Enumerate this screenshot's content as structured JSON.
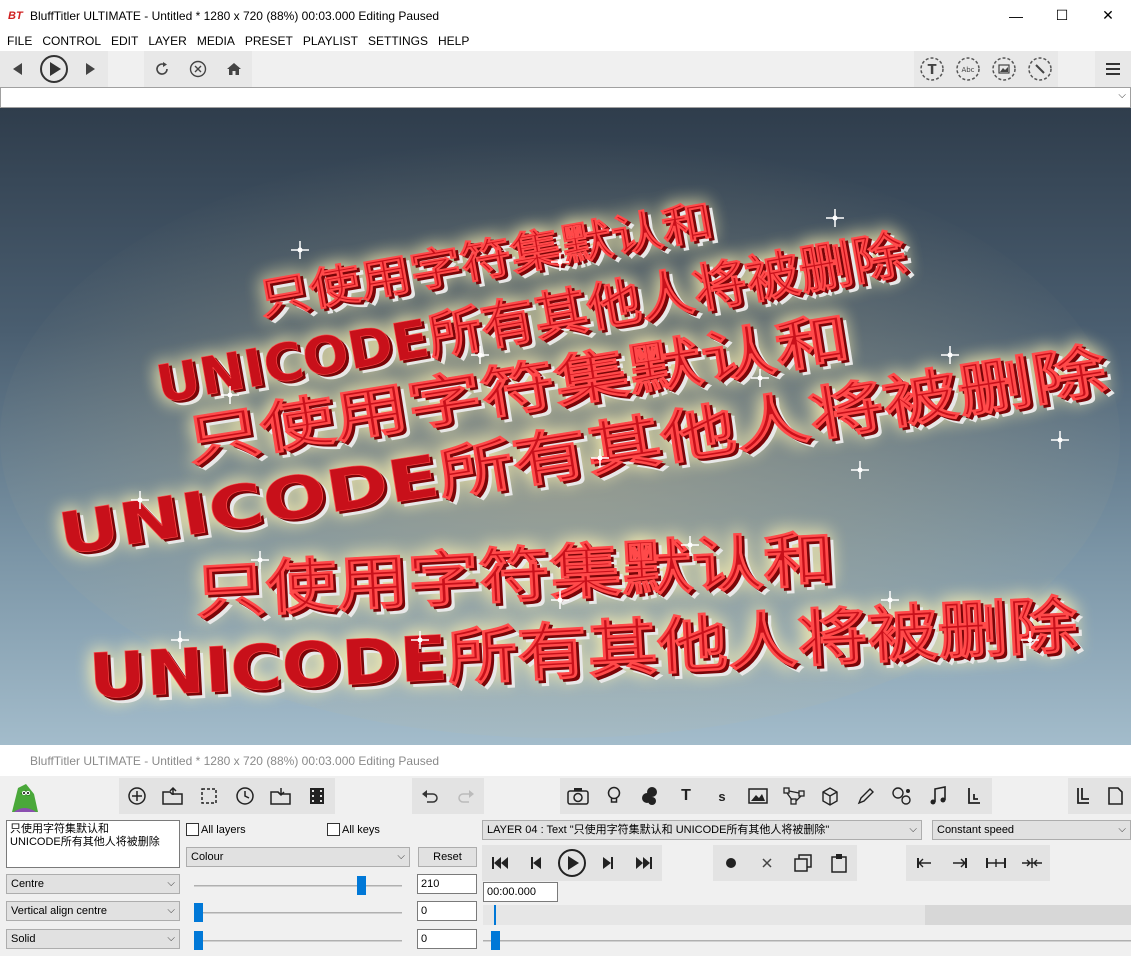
{
  "window": {
    "logo": "BT",
    "title": "BluffTitler ULTIMATE  - Untitled * 1280 x 720 (88%) 00:03.000 Editing Paused",
    "minimize": "—",
    "maximize": "☐",
    "close": "✕"
  },
  "menu": [
    "FILE",
    "CONTROL",
    "EDIT",
    "LAYER",
    "MEDIA",
    "PRESET",
    "PLAYLIST",
    "SETTINGS",
    "HELP"
  ],
  "preview": {
    "lines": [
      "只使用字符集默认和",
      "UNICODE所有其他人将被删除",
      "只使用字符集默认和",
      "UNICODE所有其他人将被删除",
      "只使用字符集默认和",
      "UNICODE所有其他人将被删除"
    ],
    "colors": {
      "text": "#c8101a",
      "shadow": "#7a0508",
      "glow": "#fff3b0"
    }
  },
  "lower": {
    "title": "BluffTitler ULTIMATE  - Untitled * 1280 x 720 (88%) 00:03.000 Editing Paused",
    "text_lines": [
      "只使用字符集默认和",
      "UNICODE所有其他人将被删除"
    ],
    "all_layers": "All layers",
    "all_keys": "All keys",
    "property_select": "Colour",
    "reset": "Reset",
    "layer_select": "LAYER 04       : Text \"只使用字符集默认和 UNICODE所有其他人将被删除\"",
    "speed_select": "Constant speed",
    "time": "00:00.000",
    "rows": [
      {
        "select": "Centre",
        "value": "210"
      },
      {
        "select": "Vertical align centre",
        "value": "0"
      },
      {
        "select": "Solid",
        "value": "0"
      }
    ],
    "text_tool": "T",
    "style_tool": "s"
  }
}
